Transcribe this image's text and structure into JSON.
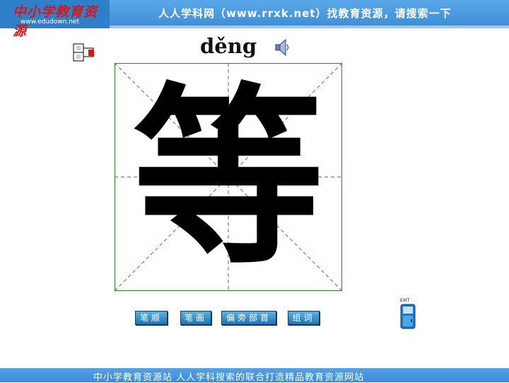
{
  "header": {
    "logo_text": "中小学教育资源",
    "logo_url": "www.edudown.net",
    "slogan": "人人学科网（www.rrxk.net）找教育资源，请搜索一下"
  },
  "lesson": {
    "pinyin": "děng",
    "character": "等"
  },
  "icons": {
    "speaker": "speaker-icon",
    "tiles": "puzzle-tiles-icon",
    "exit": "exit-door-icon"
  },
  "buttons": {
    "stroke_order": "笔顺",
    "stroke_count": "笔画",
    "radical": "偏旁部首",
    "word_building": "组词"
  },
  "exit": {
    "label": "EXIT"
  },
  "footer": {
    "text": "中小学教育资源站 人人学科搜索的联合打造精品教育资源网站"
  },
  "colors": {
    "header_blue": "#3f8fd8",
    "grid_green": "#2e8b2e",
    "button_blue": "#1f74b5"
  }
}
